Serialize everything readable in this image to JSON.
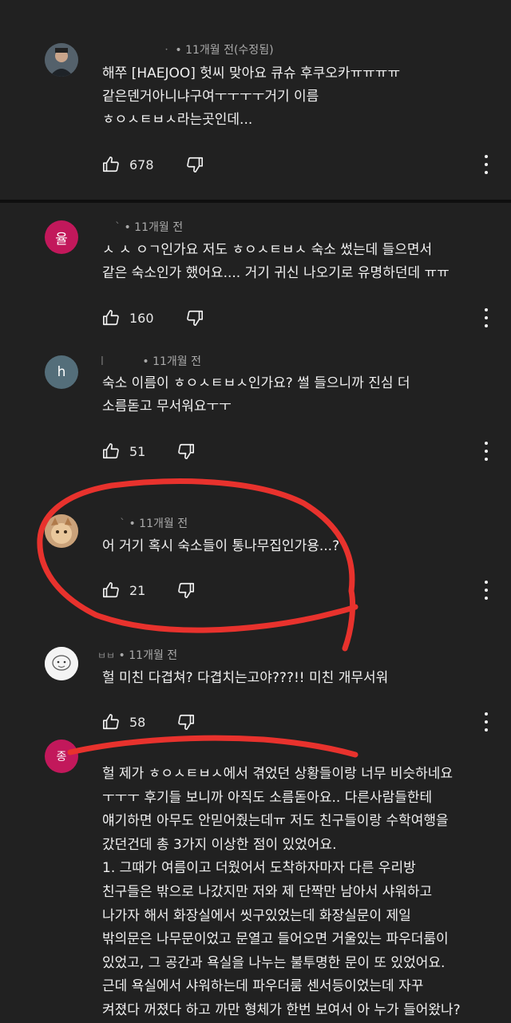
{
  "comments": [
    {
      "avatar_letter": "",
      "name": "ㆍ",
      "time": "11개월 전(수정됨)",
      "text": "해쭈 [HAEJOO] 헛씨 맞아요 큐슈 후쿠오카ㅠㅠㅠㅠ\n같은덴거아니냐구여ㅜㅜㅜㅜ거기 이름\nㅎㅇㅅㅌㅂㅅ라는곳인데...",
      "likes": "678"
    },
    {
      "avatar_letter": "율",
      "name": "ˋ",
      "time": "11개월 전",
      "text": "ㅅ ㅅ ㅇㄱ인가요 저도 ㅎㅇㅅㅌㅂㅅ 숙소 썼는데 들으면서\n같은 숙소인가 했어요.... 거기 귀신 나오기로 유명하던데 ㅠㅠ",
      "likes": "160"
    },
    {
      "avatar_letter": "h",
      "name": "l",
      "time": "11개월 전",
      "text": "숙소 이름이 ㅎㅇㅅㅌㅂㅅ인가요? 썰 들으니까 진심 더\n소름돋고 무서워요ㅜㅜ",
      "likes": "51"
    },
    {
      "avatar_letter": "",
      "name": "ˋ",
      "time": "11개월 전",
      "text": "어 거기 혹시 숙소들이 통나무집인가용...?",
      "likes": "21"
    },
    {
      "avatar_letter": "",
      "name": "ㅂㅂ",
      "time": "11개월 전",
      "text": "헐 미친 다겹쳐? 다겹치는고야???!! 미친 개무서워",
      "likes": "58"
    },
    {
      "avatar_letter": "종",
      "name": "",
      "time": "",
      "text": "헐 제가 ㅎㅇㅅㅌㅂㅅ에서 겪었던 상황들이랑 너무 비슷하네요\nㅜㅜㅜ 후기들 보니까 아직도 소름돋아요.. 다른사람들한테\n얘기하면 아무도 안믿어줬는데ㅠ 저도 친구들이랑 수학여행을\n갔던건데 총 3가지 이상한 점이 있었어요.\n1. 그때가 여름이고 더웠어서 도착하자마자 다른 우리방\n친구들은 밖으로 나갔지만 저와 제 단짝만 남아서 샤워하고\n나가자 해서 화장실에서 씻구있었는데 화장실문이 제일\n밖의문은 나무문이었고 문열고 들어오면 거울있는 파우더룸이\n있었고, 그 공간과 욕실을 나누는 불투명한 문이 또 있었어요.\n근데 욕실에서 샤워하는데 파우더룸 센서등이었는데 자꾸\n켜졌다 꺼졌다 하고 까만 형체가 한번 보여서 아 누가 들어왔나?",
      "likes": ""
    }
  ],
  "colors": {
    "background": "#212121",
    "text": "#f1f1f1",
    "meta": "#aaaaaa",
    "annotation": "#e8322d",
    "avatar_pink": "#c2185b"
  },
  "icons": {
    "like": "thumbs-up-icon",
    "dislike": "thumbs-down-icon",
    "more": "more-vert-icon"
  }
}
